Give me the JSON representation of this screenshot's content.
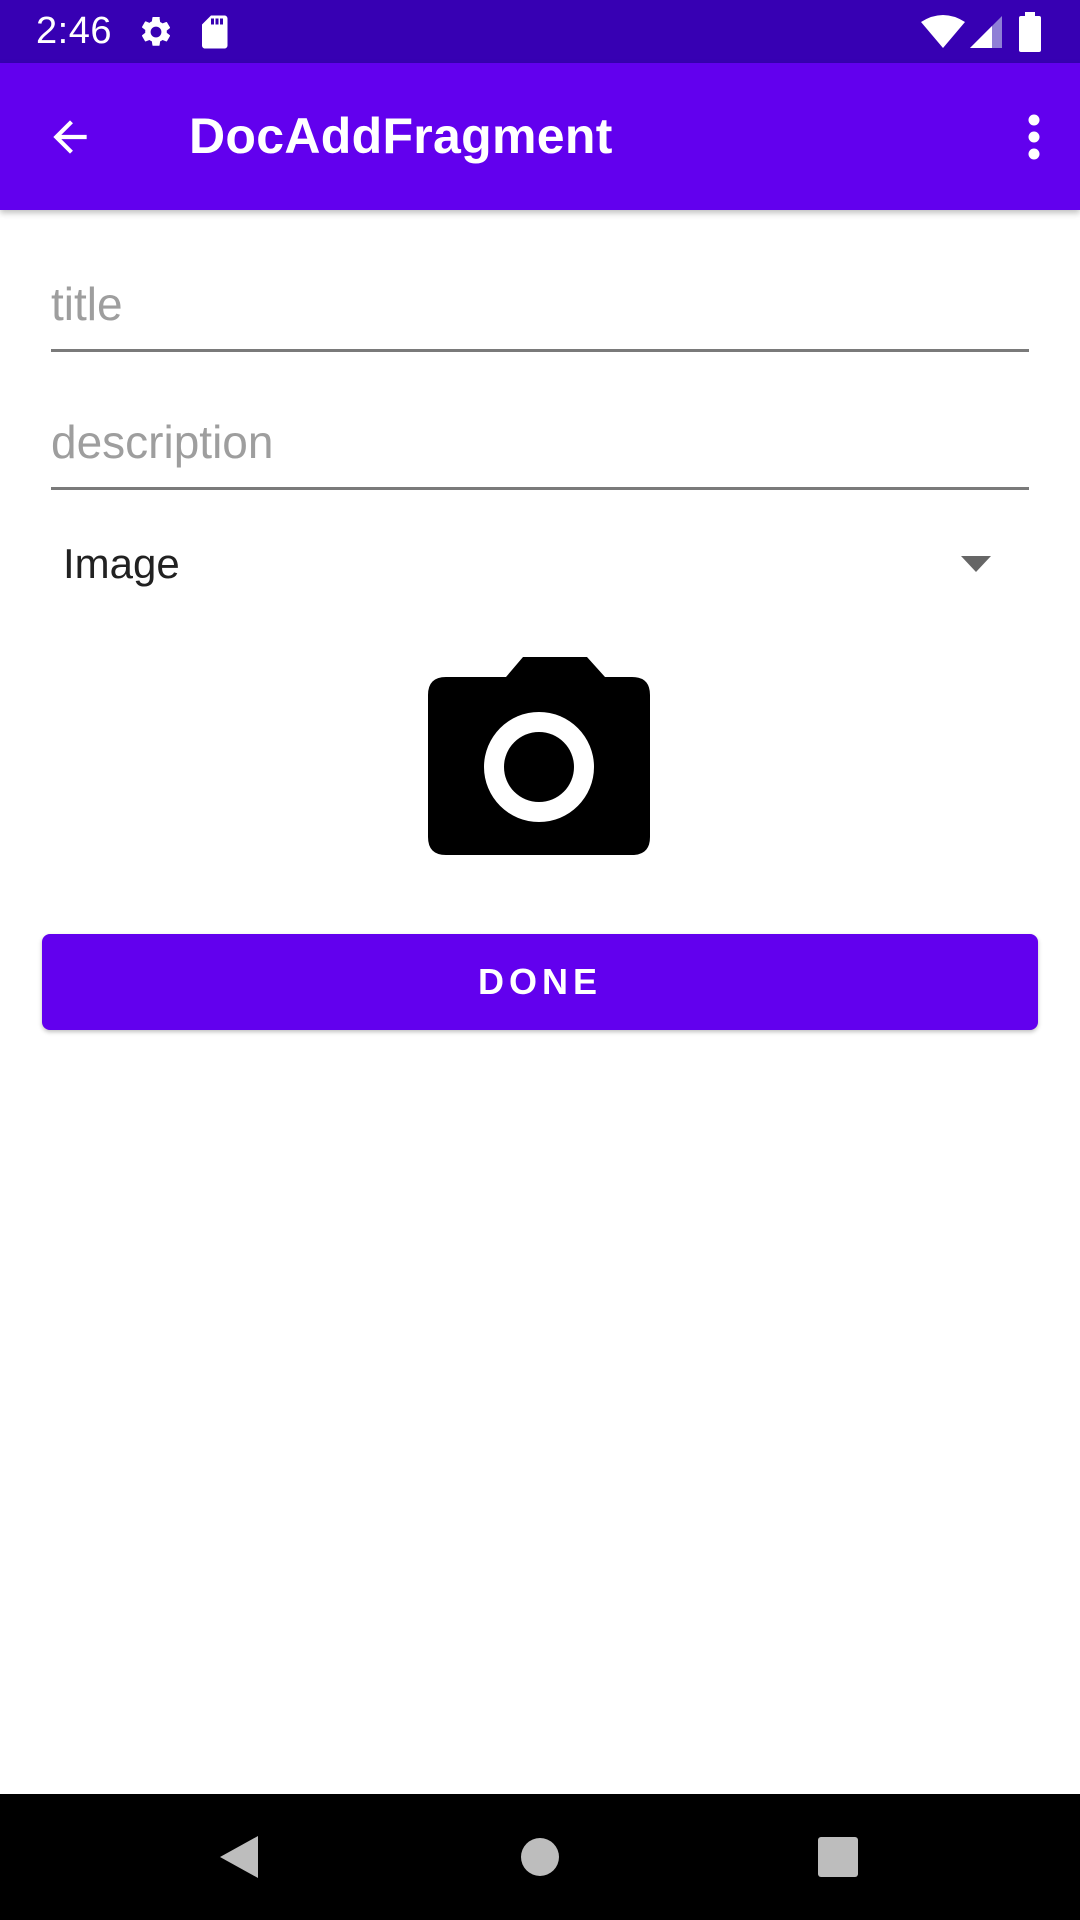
{
  "status_bar": {
    "time": "2:46",
    "icons": [
      "settings-icon",
      "sd-card-icon",
      "wifi-icon",
      "cell-signal-icon",
      "battery-icon"
    ]
  },
  "app_bar": {
    "title": "DocAddFragment",
    "back_icon": "arrow-back-icon",
    "overflow_icon": "more-vert-icon"
  },
  "form": {
    "title_placeholder": "title",
    "title_value": "",
    "description_placeholder": "description",
    "description_value": "",
    "type_selected": "Image",
    "camera_icon": "camera-icon",
    "done_label": "DONE"
  },
  "nav_bar": {
    "icons": [
      "nav-back-icon",
      "nav-home-icon",
      "nav-recents-icon"
    ]
  },
  "colors": {
    "status_bar": "#3700b3",
    "primary": "#6200ee",
    "background": "#ffffff"
  }
}
